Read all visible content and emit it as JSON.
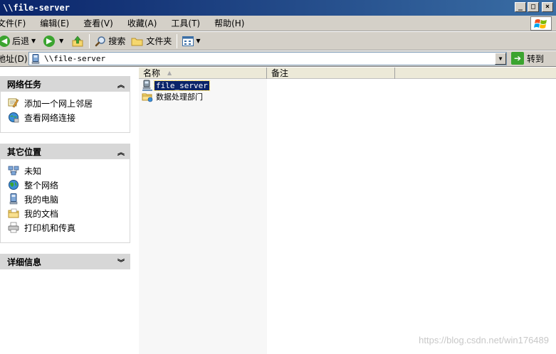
{
  "window": {
    "title": "\\\\file-server",
    "min_label": "_",
    "max_label": "□",
    "close_label": "×"
  },
  "menubar": {
    "items": [
      "文件(F)",
      "编辑(E)",
      "查看(V)",
      "收藏(A)",
      "工具(T)",
      "帮助(H)"
    ]
  },
  "toolbar": {
    "back_label": "后退",
    "search_label": "搜索",
    "folders_label": "文件夹"
  },
  "address": {
    "label": "地址(D)",
    "value": "\\\\file-server",
    "go_label": "转到"
  },
  "taskpane": {
    "network_tasks": {
      "title": "网络任务",
      "items": [
        "添加一个网上邻居",
        "查看网络连接"
      ]
    },
    "other_places": {
      "title": "其它位置",
      "items": [
        "未知",
        "整个网络",
        "我的电脑",
        "我的文档",
        "打印机和传真"
      ]
    },
    "details": {
      "title": "详细信息"
    }
  },
  "filelist": {
    "columns": [
      "名称",
      "备注"
    ],
    "rows": [
      {
        "name": "file_server",
        "selected": true
      },
      {
        "name": "数据处理部门",
        "selected": false
      }
    ]
  },
  "watermark": "https://blog.csdn.net/win176489",
  "colors": {
    "titlebar": "#0a246a",
    "chrome": "#d4d0c8",
    "selection": "#0a246a",
    "go_green": "#3ba42f"
  }
}
